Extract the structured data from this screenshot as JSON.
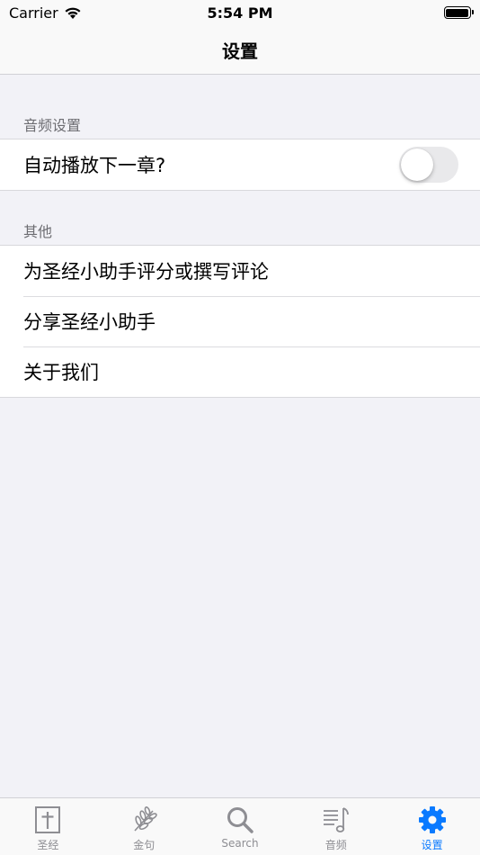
{
  "status_bar": {
    "carrier": "Carrier",
    "time": "5:54 PM"
  },
  "nav": {
    "title": "设置"
  },
  "sections": {
    "audio": {
      "header": "音频设置",
      "autoplay": {
        "label": "自动播放下一章?",
        "enabled": false
      }
    },
    "other": {
      "header": "其他",
      "rate": "为圣经小助手评分或撰写评论",
      "share": "分享圣经小助手",
      "about": "关于我们"
    }
  },
  "tab_bar": {
    "accent": "#0a7aff",
    "inactive": "#8e8e93",
    "tabs": [
      {
        "label": "圣经",
        "icon": "bible-cross-icon"
      },
      {
        "label": "金句",
        "icon": "olive-branch-icon"
      },
      {
        "label": "Search",
        "icon": "search-icon"
      },
      {
        "label": "音频",
        "icon": "music-note-icon"
      },
      {
        "label": "设置",
        "icon": "gear-icon",
        "active": true
      }
    ]
  }
}
